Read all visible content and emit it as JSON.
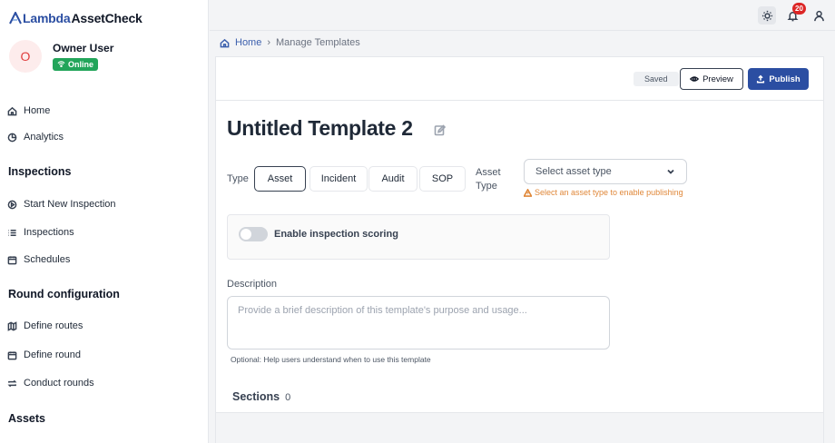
{
  "brand": {
    "part1": "Lambda",
    "part2": "AssetCheck",
    "accent": "#2b4ea2"
  },
  "user": {
    "initial": "O",
    "name": "Owner User",
    "status": "Online"
  },
  "sidebar": {
    "items": [
      {
        "label": "Home",
        "icon": "home-icon"
      },
      {
        "label": "Analytics",
        "icon": "pie-chart-icon"
      }
    ],
    "inspections_heading": "Inspections",
    "inspections_items": [
      {
        "label": "Start New Inspection",
        "icon": "play-circle-icon"
      },
      {
        "label": "Inspections",
        "icon": "list-icon"
      },
      {
        "label": "Schedules",
        "icon": "calendar-icon"
      }
    ],
    "round_heading": "Round configuration",
    "round_items": [
      {
        "label": "Define routes",
        "icon": "map-icon"
      },
      {
        "label": "Define round",
        "icon": "calendar-icon"
      },
      {
        "label": "Conduct rounds",
        "icon": "repeat-icon"
      }
    ],
    "assets_heading": "Assets"
  },
  "topbar": {
    "notification_count": "20"
  },
  "breadcrumb": {
    "home": "Home",
    "current": "Manage Templates"
  },
  "toolbar": {
    "saved": "Saved",
    "preview": "Preview",
    "publish": "Publish"
  },
  "template": {
    "title": "Untitled Template 2",
    "type_label": "Type",
    "types": [
      "Asset",
      "Incident",
      "Audit",
      "SOP"
    ],
    "selected_type": "Asset",
    "asset_type_label_1": "Asset",
    "asset_type_label_2": "Type",
    "asset_type_placeholder": "Select asset type",
    "asset_type_warning": "Select an asset type to enable publishing",
    "scoring_label": "Enable inspection scoring",
    "scoring_enabled": false,
    "description_label": "Description",
    "description_placeholder": "Provide a brief description of this template's purpose and usage...",
    "description_help": "Optional: Help users understand when to use this template",
    "sections_label": "Sections",
    "sections_count": "0"
  }
}
